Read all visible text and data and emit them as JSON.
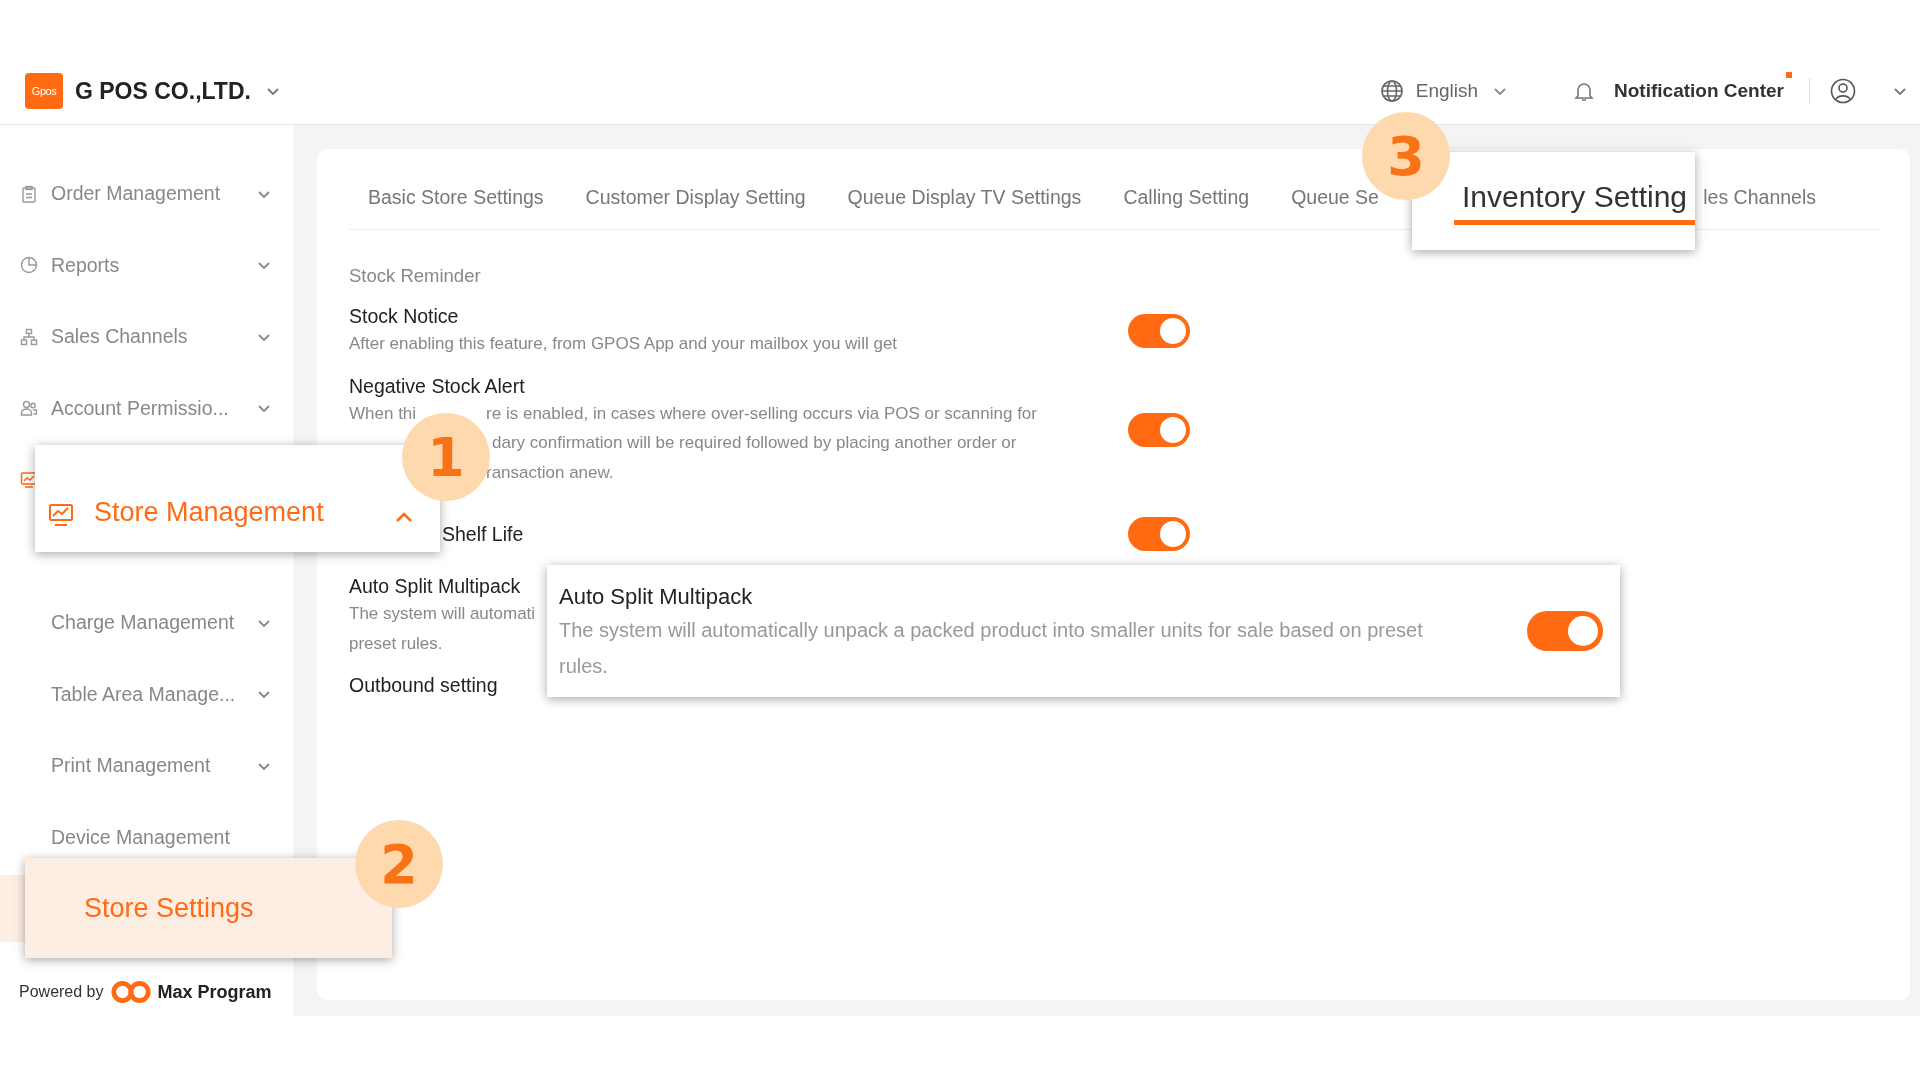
{
  "header": {
    "logo_text": "Gpos",
    "company": "G POS CO.,LTD.",
    "language": "English",
    "notifications": {
      "label": "Notification Center",
      "unread": true
    }
  },
  "sidebar": {
    "items_top": [
      {
        "label": "Order Management",
        "expanded": false
      },
      {
        "label": "Reports",
        "expanded": false
      },
      {
        "label": "Sales Channels",
        "expanded": false
      },
      {
        "label": "Account Permissio...",
        "expanded": false
      }
    ],
    "items_bottom": [
      {
        "label": "Charge Management",
        "kind": "expandable",
        "expanded": false
      },
      {
        "label": "Table Area Manage...",
        "kind": "expandable",
        "expanded": false
      },
      {
        "label": "Print Management",
        "kind": "expandable",
        "expanded": false
      },
      {
        "label": "Device Management",
        "kind": "link"
      }
    ],
    "footer": {
      "prefix": "Powered by",
      "brand": "Max Program"
    }
  },
  "tabs": [
    {
      "label": "Basic Store Settings",
      "selected": false
    },
    {
      "label": "Customer Display Setting",
      "selected": false
    },
    {
      "label": "Queue Display TV Settings",
      "selected": false
    },
    {
      "label": "Calling Setting",
      "selected": false
    },
    {
      "label": "Queue Se",
      "selected": false
    },
    {
      "label": "les Channels",
      "selected": false
    }
  ],
  "section": {
    "heading": "Stock Reminder",
    "settings": [
      {
        "title": "Stock Notice",
        "description_lines": [
          [
            "After enabling this feature, from GPOS App and your mailbox you will get"
          ]
        ],
        "on": true
      },
      {
        "title": "Negative Stock Alert",
        "description_lines": [
          [
            "When thi",
            "re is enabled, in cases where over-selling occurs via POS or scanning for"
          ],
          [
            "dary confirmation will be required followed by placing another order or"
          ],
          [
            "ransaction anew."
          ]
        ],
        "on": true
      },
      {
        "title": "Shelf Life",
        "on": true
      },
      {
        "title": "Auto Split Multipack",
        "description_lines": [
          [
            "The system will automati"
          ],
          [
            "preset rules."
          ]
        ]
      },
      {
        "title": "Outbound setting"
      }
    ]
  },
  "callouts": [
    {
      "number": "1",
      "kind": "menu_group",
      "label": "Store Management",
      "expanded": true
    },
    {
      "number": "2",
      "kind": "menu_item",
      "label": "Store Settings",
      "selected": true
    },
    {
      "number": "3",
      "kind": "tab",
      "label": "Inventory Setting",
      "selected": true
    },
    {
      "kind": "setting",
      "title": "Auto Split Multipack",
      "description": "The system will automatically unpack a packed product into smaller units for sale based on preset rules.",
      "on": true
    }
  ]
}
